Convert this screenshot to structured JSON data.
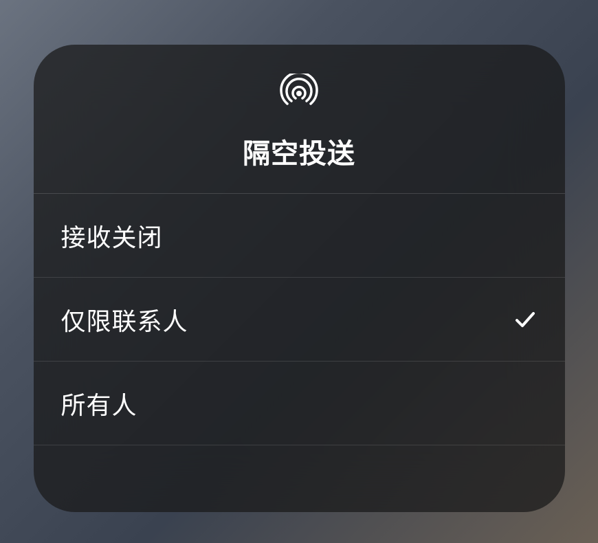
{
  "header": {
    "title": "隔空投送",
    "icon_name": "airdrop-icon"
  },
  "options": [
    {
      "label": "接收关闭",
      "selected": false
    },
    {
      "label": "仅限联系人",
      "selected": true
    },
    {
      "label": "所有人",
      "selected": false
    }
  ]
}
